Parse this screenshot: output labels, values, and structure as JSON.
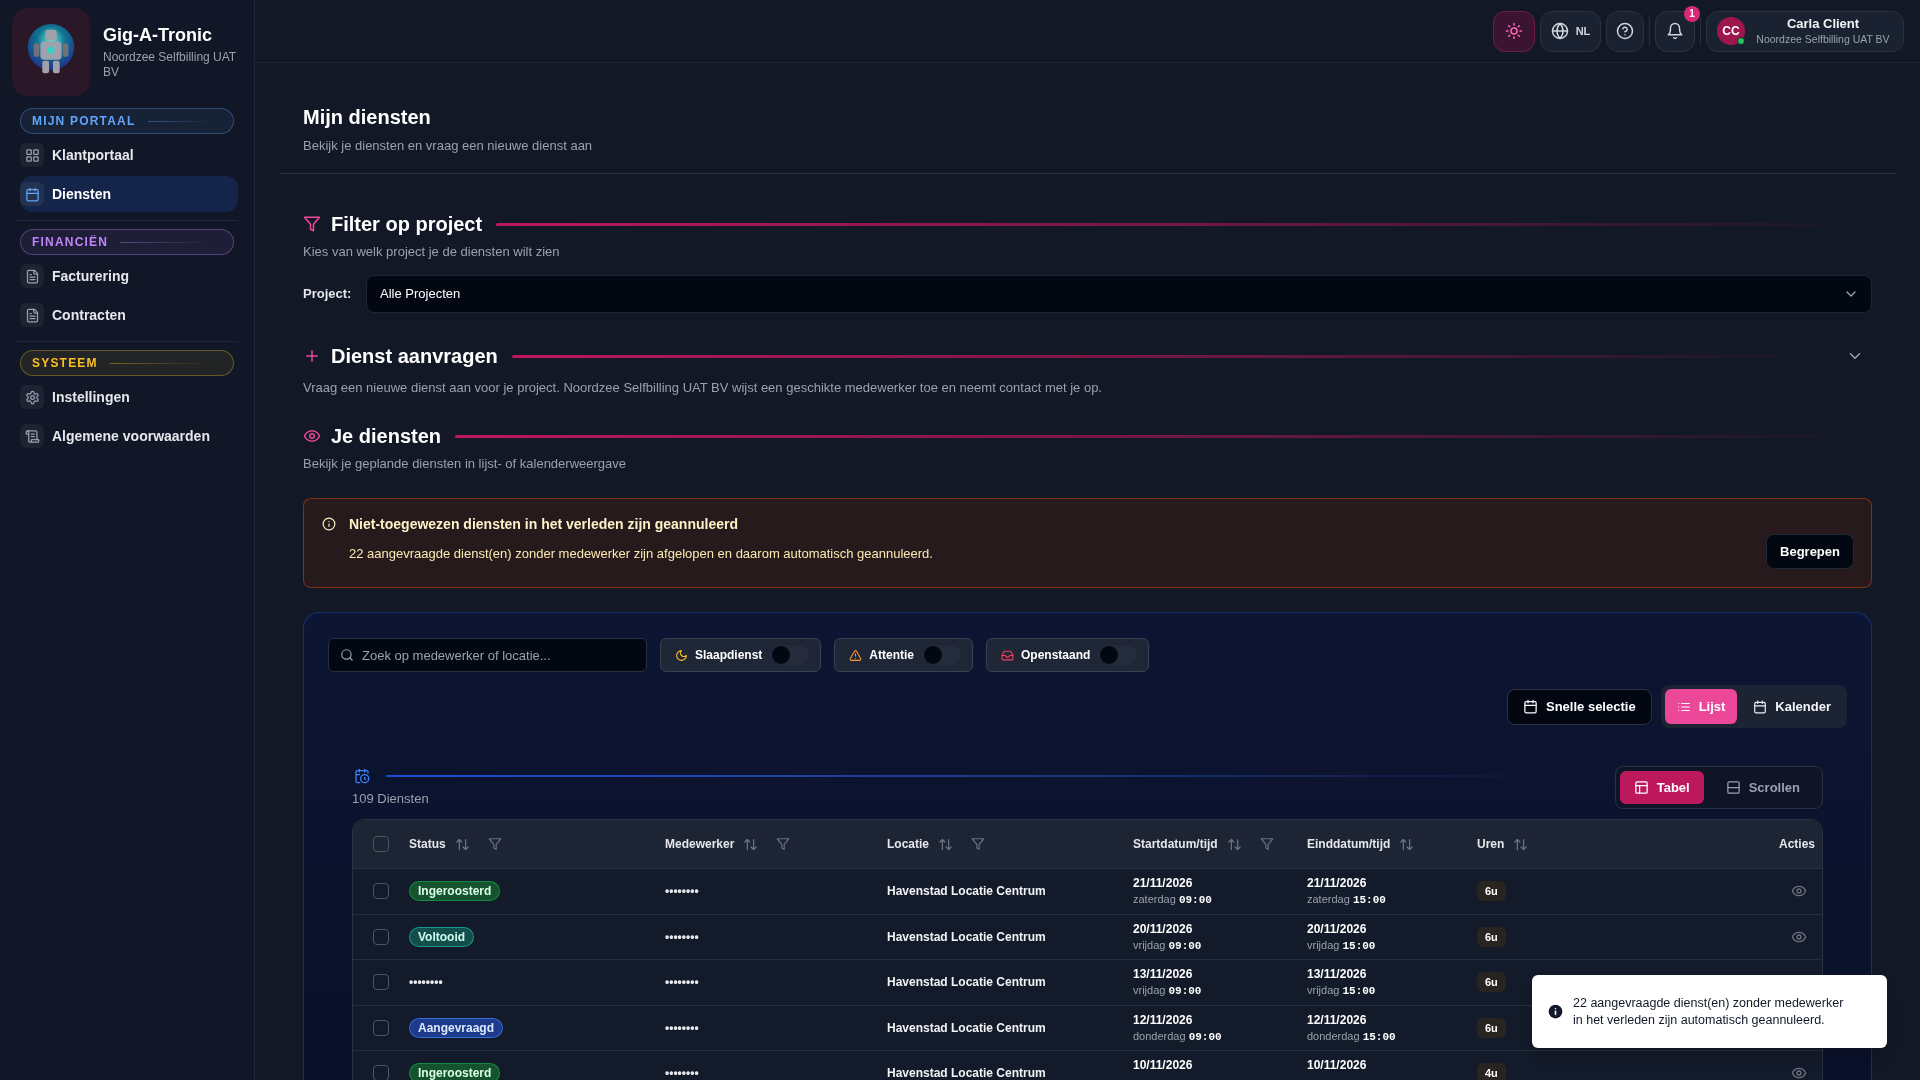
{
  "sidebar": {
    "brand": {
      "title": "Gig-A-Tronic",
      "subtitle": "Noordzee Selfbilling UAT BV"
    },
    "sections": [
      {
        "label": "MIJN PORTAAL",
        "color": "#60a5fa",
        "items": [
          {
            "label": "Klantportaal",
            "selected": false
          },
          {
            "label": "Diensten",
            "selected": true
          }
        ]
      },
      {
        "label": "FINANCIËN",
        "color": "#c084fc",
        "items": [
          {
            "label": "Facturering",
            "selected": false
          },
          {
            "label": "Contracten",
            "selected": false
          }
        ]
      },
      {
        "label": "SYSTEEM",
        "color": "#fbbf24",
        "items": [
          {
            "label": "Instellingen",
            "selected": false
          },
          {
            "label": "Algemene voorwaarden",
            "selected": false
          }
        ]
      }
    ]
  },
  "topbar": {
    "language": "NL",
    "notification_count": "1",
    "user": {
      "initials": "CC",
      "name": "Carla Client",
      "organization": "Noordzee Selfbilling UAT BV",
      "online": true
    }
  },
  "page": {
    "title": "Mijn diensten",
    "subtitle": "Bekijk je diensten en vraag een nieuwe dienst aan"
  },
  "filter_section": {
    "title": "Filter op project",
    "subtitle": "Kies van welk project je de diensten wilt zien",
    "field_label": "Project:",
    "value": "Alle Projecten"
  },
  "request_section": {
    "title": "Dienst aanvragen",
    "subtitle": "Vraag een nieuwe dienst aan voor je project. Noordzee Selfbilling UAT BV wijst een geschikte medewerker toe en neemt contact met je op.",
    "expanded": false
  },
  "services_section": {
    "title": "Je diensten",
    "subtitle": "Bekijk je geplande diensten in lijst- of kalenderweergave"
  },
  "alert": {
    "title": "Niet-toegewezen diensten in het verleden zijn geannuleerd",
    "message": "22 aangevraagde dienst(en) zonder medewerker zijn afgelopen en daarom automatisch geannuleerd.",
    "button": "Begrepen"
  },
  "toolbar": {
    "search": {
      "placeholder": "Zoek op medewerker of locatie..."
    },
    "toggles": [
      {
        "label": "Slaapdienst",
        "on": false
      },
      {
        "label": "Attentie",
        "on": false
      },
      {
        "label": "Openstaand",
        "on": false
      }
    ],
    "quick_select": "Snelle selectie",
    "view_tabs": [
      {
        "label": "Lijst",
        "selected": true
      },
      {
        "label": "Kalender",
        "selected": false
      }
    ]
  },
  "summary": {
    "count": "109 Diensten",
    "layout_tabs": [
      {
        "label": "Tabel",
        "selected": true
      },
      {
        "label": "Scrollen",
        "selected": false
      }
    ]
  },
  "table": {
    "all_checked": false,
    "columns": [
      {
        "label": "Status",
        "sortable": true,
        "filterable": true
      },
      {
        "label": "Medewerker",
        "sortable": true,
        "filterable": true
      },
      {
        "label": "Locatie",
        "sortable": true,
        "filterable": true
      },
      {
        "label": "Startdatum/tijd",
        "sortable": true,
        "filterable": true
      },
      {
        "label": "Einddatum/tijd",
        "sortable": true,
        "filterable": false
      },
      {
        "label": "Uren",
        "sortable": true,
        "filterable": false
      },
      {
        "label": "Acties",
        "sortable": false,
        "filterable": false
      }
    ],
    "rows": [
      {
        "checked": false,
        "status": {
          "label": "Ingeroosterd",
          "kind": "scheduled"
        },
        "employee": "••••••••",
        "location": "Havenstad Locatie Centrum",
        "start": {
          "date": "21/11/2026",
          "day": "zaterdag",
          "time": "09:00"
        },
        "end": {
          "date": "21/11/2026",
          "day": "zaterdag",
          "time": "15:00"
        },
        "hours": "6u",
        "view_action": true
      },
      {
        "checked": false,
        "status": {
          "label": "Voltooid",
          "kind": "done"
        },
        "employee": "••••••••",
        "location": "Havenstad Locatie Centrum",
        "start": {
          "date": "20/11/2026",
          "day": "vrijdag",
          "time": "09:00"
        },
        "end": {
          "date": "20/11/2026",
          "day": "vrijdag",
          "time": "15:00"
        },
        "hours": "6u",
        "view_action": true
      },
      {
        "checked": false,
        "status": {
          "label": "••••••••",
          "kind": "masked"
        },
        "employee": "••••••••",
        "location": "Havenstad Locatie Centrum",
        "start": {
          "date": "13/11/2026",
          "day": "vrijdag",
          "time": "09:00"
        },
        "end": {
          "date": "13/11/2026",
          "day": "vrijdag",
          "time": "15:00"
        },
        "hours": "6u",
        "view_action": false
      },
      {
        "checked": false,
        "status": {
          "label": "Aangevraagd",
          "kind": "requested"
        },
        "employee": "••••••••",
        "location": "Havenstad Locatie Centrum",
        "start": {
          "date": "12/11/2026",
          "day": "donderdag",
          "time": "09:00"
        },
        "end": {
          "date": "12/11/2026",
          "day": "donderdag",
          "time": "15:00"
        },
        "hours": "6u",
        "view_action": false
      },
      {
        "checked": false,
        "status": {
          "label": "Ingeroosterd",
          "kind": "scheduled"
        },
        "employee": "••••••••",
        "location": "Havenstad Locatie Centrum",
        "start": {
          "date": "10/11/2026"
        },
        "end": {
          "date": "10/11/2026"
        },
        "hours": "4u",
        "view_action": true
      }
    ]
  },
  "toast": {
    "message": "22 aangevraagde dienst(en) zonder medewerker in het verleden zijn automatisch geannuleerd."
  }
}
